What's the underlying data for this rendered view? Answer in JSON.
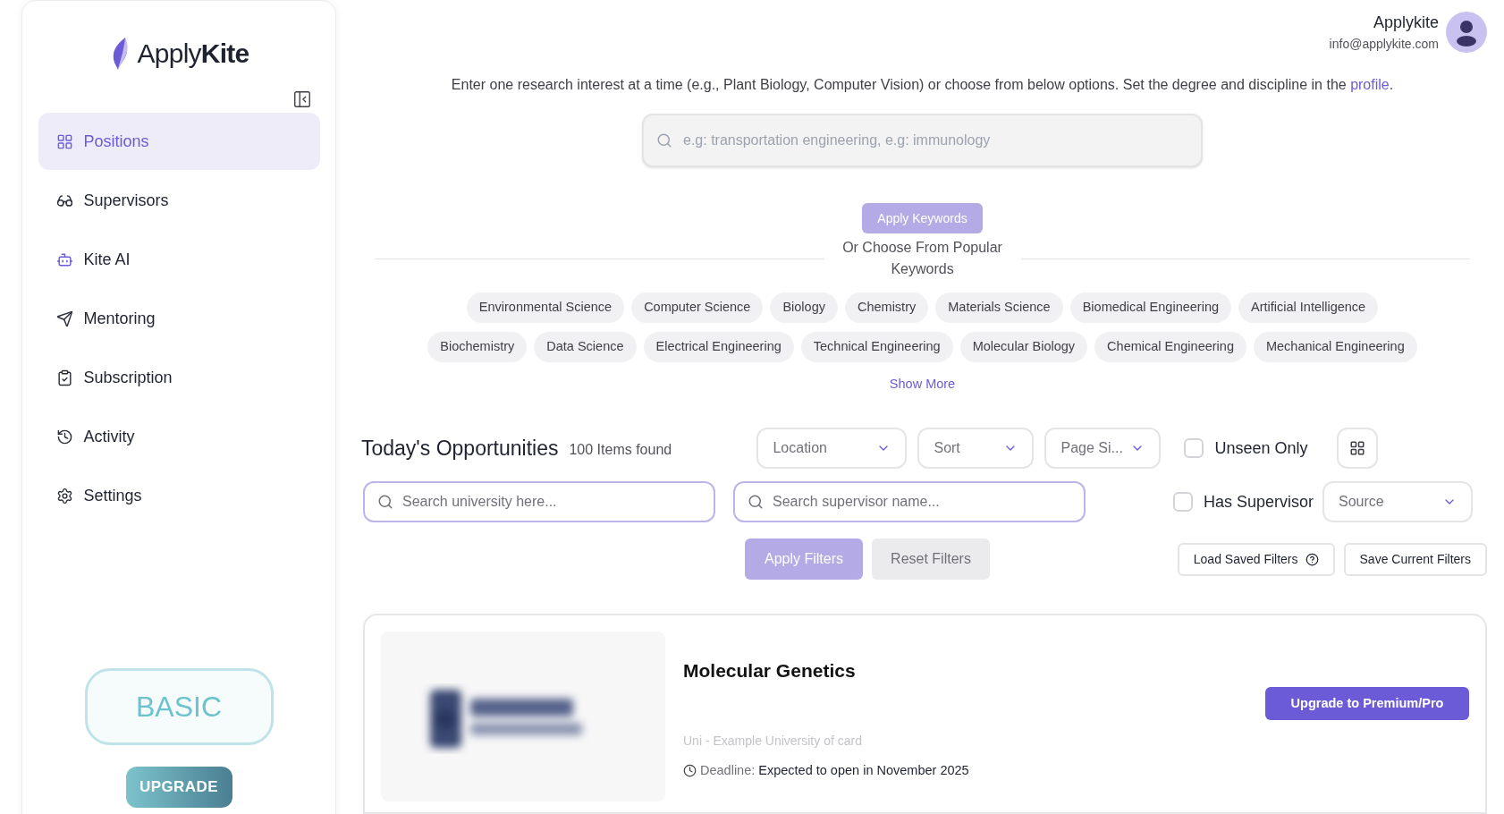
{
  "sidebar": {
    "logo": {
      "light": "Apply",
      "bold": "Kite"
    },
    "items": [
      {
        "label": "Positions",
        "selected": true
      },
      {
        "label": "Supervisors",
        "selected": false
      },
      {
        "label": "Kite AI",
        "selected": false
      },
      {
        "label": "Mentoring",
        "selected": false
      },
      {
        "label": "Subscription",
        "selected": false
      },
      {
        "label": "Activity",
        "selected": false
      },
      {
        "label": "Settings",
        "selected": false
      }
    ],
    "plan": "BASIC",
    "upgrade": "UPGRADE"
  },
  "user": {
    "name": "Applykite",
    "email": "info@applykite.com"
  },
  "intro": {
    "text": "Enter one research interest at a time (e.g., Plant Biology, Computer Vision) or choose from below options. Set the degree and discipline in the",
    "link": "profile",
    "end": "."
  },
  "keyword_search": {
    "placeholder": "e.g: transportation engineering, e.g: immunology"
  },
  "apply_keywords": "Apply Keywords",
  "popular_heading": "Or Choose From Popular Keywords",
  "keyword_rows": [
    [
      "Environmental Science",
      "Computer Science",
      "Biology",
      "Chemistry",
      "Materials Science",
      "Biomedical Engineering",
      "Artificial Intelligence"
    ],
    [
      "Biochemistry",
      "Data Science",
      "Electrical Engineering",
      "Technical Engineering",
      "Molecular Biology",
      "Chemical Engineering",
      "Mechanical Engineering"
    ]
  ],
  "show_more": "Show More",
  "opportunities": {
    "title": "Today's Opportunities",
    "count": "100 Items found",
    "dropdowns": [
      {
        "label": "Location"
      },
      {
        "label": "Sort"
      },
      {
        "label": "Page Si..."
      }
    ],
    "unseen_only": {
      "label": "Unseen Only",
      "checked": false
    },
    "university_search": {
      "placeholder": "Search university here..."
    },
    "supervisor_search": {
      "placeholder": "Search supervisor name..."
    },
    "has_supervisor": {
      "label": "Has Supervisor",
      "checked": false
    },
    "source": {
      "label": "Source"
    },
    "apply_filters": "Apply Filters",
    "reset_filters": "Reset Filters",
    "load_saved": "Load Saved Filters",
    "save_current": "Save Current Filters"
  },
  "card": {
    "title": "Molecular Genetics",
    "university": "Uni - Example University of card",
    "deadline_label": "Deadline:",
    "deadline": "Expected to open in November 2025",
    "upgrade": "Upgrade to Premium/Pro"
  }
}
